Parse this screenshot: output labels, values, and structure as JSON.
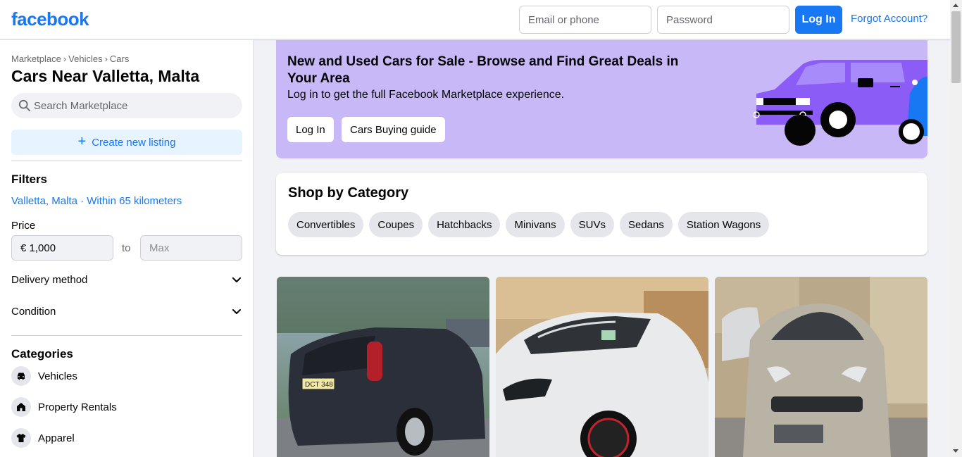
{
  "header": {
    "logo": "facebook",
    "email_placeholder": "Email or phone",
    "password_placeholder": "Password",
    "login_label": "Log In",
    "forgot_label": "Forgot Account?",
    "brand_color": "#1877f2"
  },
  "sidebar": {
    "breadcrumb": [
      "Marketplace",
      "Vehicles",
      "Cars"
    ],
    "breadcrumb_separator": "›",
    "title": "Cars Near Valletta, Malta",
    "search_placeholder": "Search Marketplace",
    "create_label": "Create new listing",
    "filters_title": "Filters",
    "location_filter": "Valletta, Malta · Within 65 kilometers",
    "price_label": "Price",
    "price_min_value": "€ 1,000",
    "price_to": "to",
    "price_max_placeholder": "Max",
    "delivery_label": "Delivery method",
    "condition_label": "Condition",
    "categories_title": "Categories",
    "categories": [
      {
        "label": "Vehicles",
        "icon": "car-icon"
      },
      {
        "label": "Property Rentals",
        "icon": "house-icon"
      },
      {
        "label": "Apparel",
        "icon": "shirt-icon"
      }
    ]
  },
  "hero": {
    "title": "New and Used Cars for Sale - Browse and Find Great Deals in Your Area",
    "subtitle": "Log in to get the full Facebook Marketplace experience.",
    "login_label": "Log In",
    "guide_label": "Cars Buying guide",
    "background_color": "#c9b8f7"
  },
  "category_card": {
    "title": "Shop by Category",
    "chips": [
      "Convertibles",
      "Coupes",
      "Hatchbacks",
      "Minivans",
      "SUVs",
      "Sedans",
      "Station Wagons"
    ]
  },
  "listings": [
    {
      "image": "dark-hatchback-photo",
      "plate": "DCT 348",
      "color": "#2b2f3a"
    },
    {
      "image": "white-hatchback-photo",
      "color": "#e9eaec"
    },
    {
      "image": "silver-suzuki-photo",
      "color": "#b9b3a6"
    }
  ]
}
